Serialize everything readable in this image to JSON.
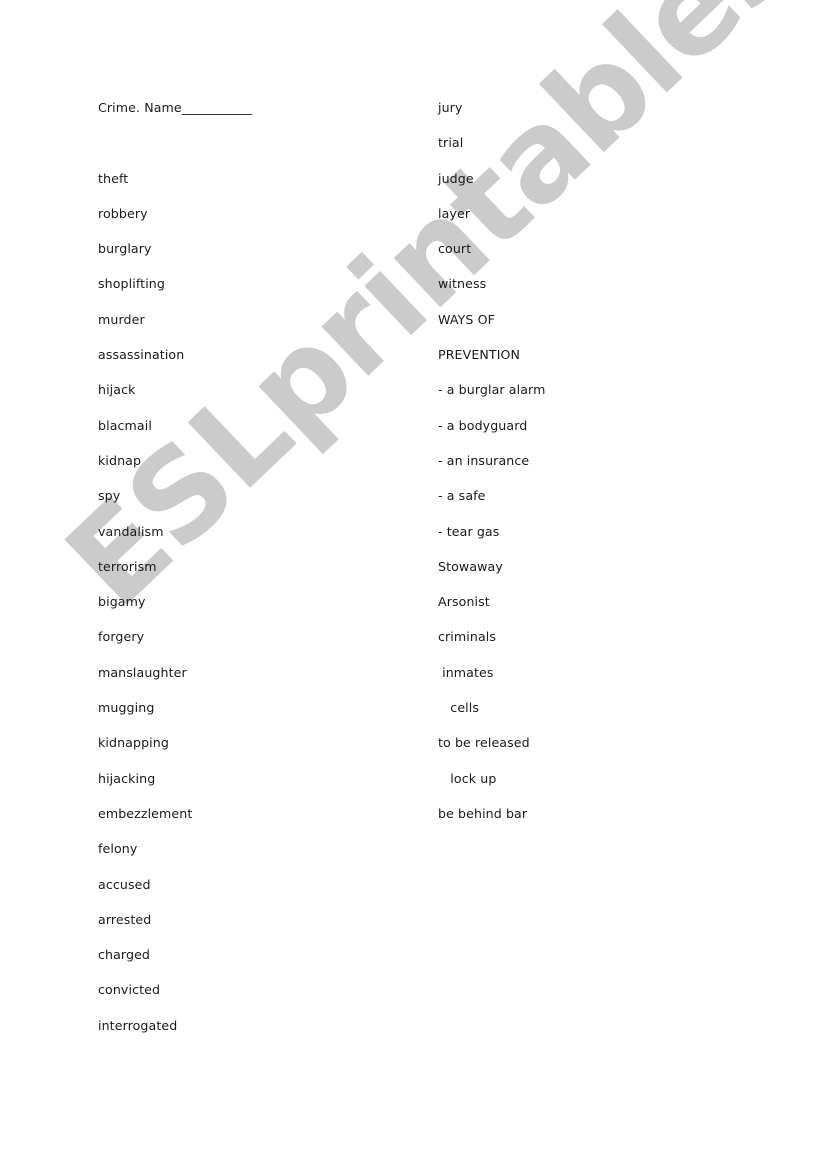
{
  "document": {
    "title": "Crime. Name___________",
    "left_column": [
      "",
      "theft",
      "robbery",
      "burglary",
      "shoplifting",
      "murder",
      "assassination",
      "hijack",
      "blacmail",
      "kidnap",
      "spy",
      "vandalism",
      "terrorism",
      "bigamy",
      "forgery",
      "manslaughter",
      "mugging",
      "kidnapping",
      "hijacking",
      "embezzlement",
      "felony",
      "accused",
      "arrested",
      "charged",
      "convicted",
      "interrogated"
    ],
    "right_column": [
      "jury",
      "trial",
      "judge",
      "layer",
      "court",
      "witness",
      "WAYS OF",
      "PREVENTION",
      "- a burglar alarm",
      "- a bodyguard",
      "- an insurance",
      "- a safe",
      "- tear gas",
      "Stowaway",
      "Arsonist",
      "criminals",
      " inmates",
      "   cells",
      "to be released",
      "   lock up",
      "be behind bar"
    ]
  },
  "watermark": {
    "text": "ESLprintables.com",
    "color": "#c9c9c9"
  }
}
